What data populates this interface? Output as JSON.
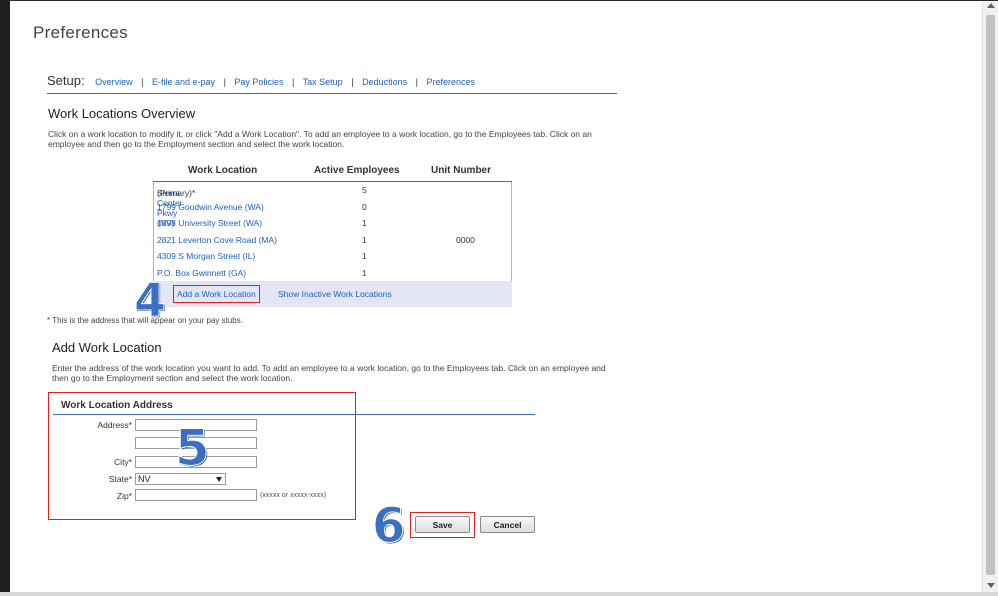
{
  "page": {
    "title": "Preferences"
  },
  "setup": {
    "label": "Setup:",
    "links": [
      "Overview",
      "E-file and e-pay",
      "Pay Policies",
      "Tax Setup",
      "Deductions",
      "Preferences"
    ],
    "separator": "|"
  },
  "overview": {
    "heading": "Work Locations Overview",
    "description": "Click on a work location to modify it, or click \"Add a Work Location\". To add an employee to a work location, go to the Employees tab. Click on an employee and then go to the Employment section and select the work location.",
    "columns": [
      "Work Location",
      "Active Employees",
      "Unit Number"
    ],
    "rows": [
      {
        "name": "Sierra Center Pkwy (NV)",
        "suffix": " (Primary)*",
        "active": "5",
        "unit": ""
      },
      {
        "name": "1799 Goodwin Avenue (WA)",
        "suffix": "",
        "active": "0",
        "unit": ""
      },
      {
        "name": "1898 University Street (WA)",
        "suffix": "",
        "active": "1",
        "unit": ""
      },
      {
        "name": "2821 Leverton Cove Road (MA)",
        "suffix": "",
        "active": "1",
        "unit": "0000"
      },
      {
        "name": "4309 S Morgan Street (IL)",
        "suffix": "",
        "active": "1",
        "unit": ""
      },
      {
        "name": "P.O. Box Gwinnett (GA)",
        "suffix": "",
        "active": "1",
        "unit": ""
      }
    ],
    "add_link": "Add a Work Location",
    "inactive_link": "Show Inactive Work Locations",
    "footnote": "* This is the address that will appear on your pay stubs."
  },
  "add": {
    "heading": "Add Work Location",
    "description": "Enter the address of the work location you want to add. To add an employee to a work location, go to the Employees tab. Click on an employee and then go to the Employment section and select the work location.",
    "section_title": "Work Location Address",
    "address_label": "Address*",
    "city_label": "City*",
    "state_label": "State*",
    "state_value": "NV",
    "zip_label": "Zip*",
    "zip_hint": "(xxxxx or xxxxx-xxxx)",
    "save": "Save",
    "cancel": "Cancel"
  },
  "annotations": {
    "step4": "4",
    "step5": "5",
    "step6": "6"
  },
  "colors": {
    "link": "#1f5fbf",
    "accent_rule": "#3a6fb0",
    "highlight": "#e02020",
    "step_number": "#3a6fc4"
  }
}
